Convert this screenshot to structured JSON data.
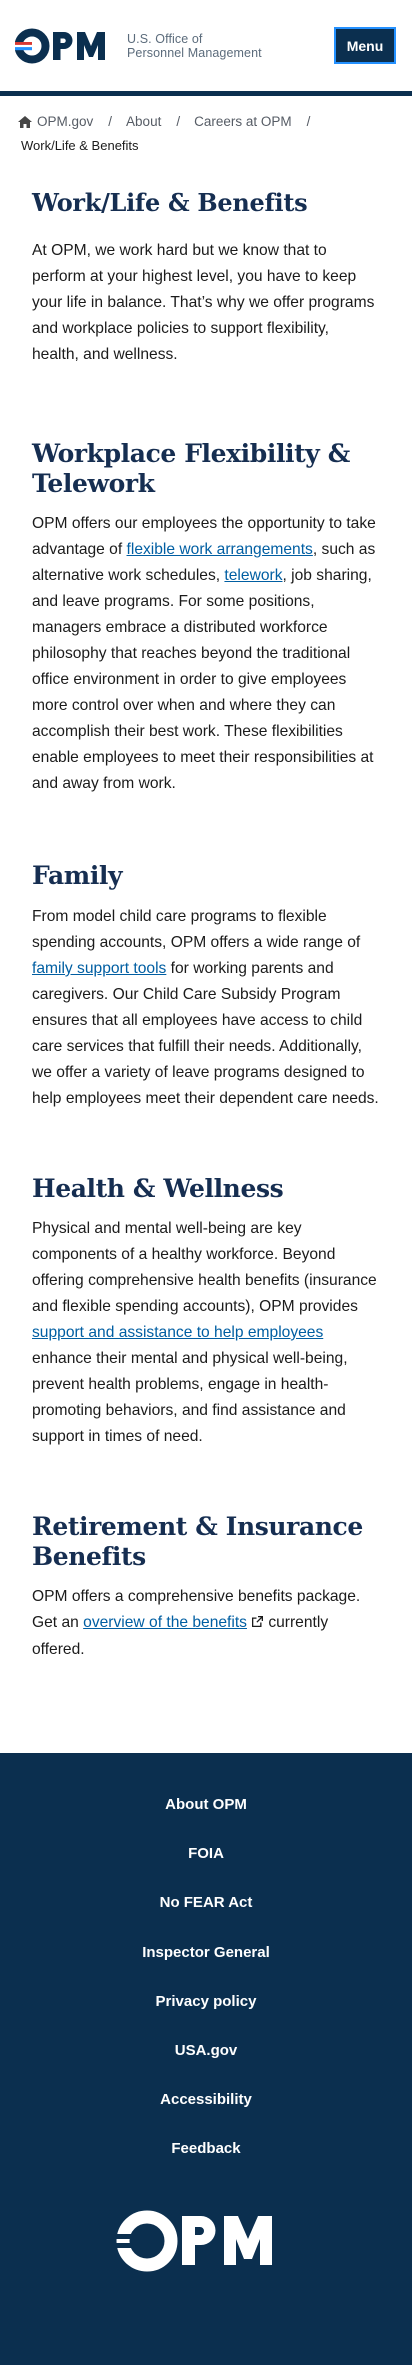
{
  "header": {
    "logo_text": "OPM",
    "agency_line1": "U.S. Office of",
    "agency_line2": "Personnel Management",
    "menu_label": "Menu",
    "logo_colors": {
      "navy": "#0b2f4f",
      "red": "#d83933",
      "blue": "#2491ff"
    }
  },
  "breadcrumb": {
    "items": [
      {
        "label": "OPM.gov",
        "icon": "home-icon"
      },
      {
        "label": "About"
      },
      {
        "label": "Careers at OPM"
      }
    ],
    "separator": "/",
    "current": "Work/Life & Benefits"
  },
  "page": {
    "title": "Work/Life & Benefits",
    "intro": "At OPM, we work hard but we know that to perform at your highest level, you have to keep your life in balance. That’s why we offer programs and workplace policies to support flexibility, health, and wellness."
  },
  "sections": {
    "flex": {
      "heading": "Workplace Flexibility & Telework",
      "p_a": "OPM offers our employees the opportunity to take advantage of ",
      "link1": "flexible work arrangements",
      "p_b": ", such as alternative work schedules, ",
      "link2": "telework",
      "p_c": ", job sharing, and leave programs. For some positions, managers embrace a distributed workforce philosophy that reaches beyond the traditional office environment in order to give employees more control over when and where they can accomplish their best work. These flexibilities enable employees to meet their responsibilities at and away from work."
    },
    "family": {
      "heading": "Family",
      "p_a": "From model child care programs to flexible spending accounts, OPM offers a wide range of ",
      "link1": "family support tools",
      "p_b": " for working parents and caregivers. Our Child Care Subsidy Program ensures that all employees have access to child care services that fulfill their needs. Additionally, we offer a variety of leave programs designed to help employees meet their dependent care needs."
    },
    "health": {
      "heading": "Health & Wellness",
      "p_a": "Physical and mental well-being are key components of a healthy workforce. Beyond offering comprehensive health benefits (insurance and flexible spending accounts), OPM provides ",
      "link1": "support and assistance to help employees",
      "p_b": " enhance their mental and physical well-being, prevent health problems, engage in health-promoting behaviors, and find assistance and support in times of need."
    },
    "retire": {
      "heading": "Retirement & Insurance Benefits",
      "p_a": "OPM offers a comprehensive benefits package. Get an ",
      "link1": "overview of the benefits",
      "p_b": " currently offered."
    }
  },
  "footer": {
    "links": [
      "About OPM",
      "FOIA",
      "No FEAR Act",
      "Inspector General",
      "Privacy policy",
      "USA.gov",
      "Accessibility",
      "Feedback"
    ],
    "logo_text": "OPM",
    "bg_color": "#0b2f4f"
  }
}
